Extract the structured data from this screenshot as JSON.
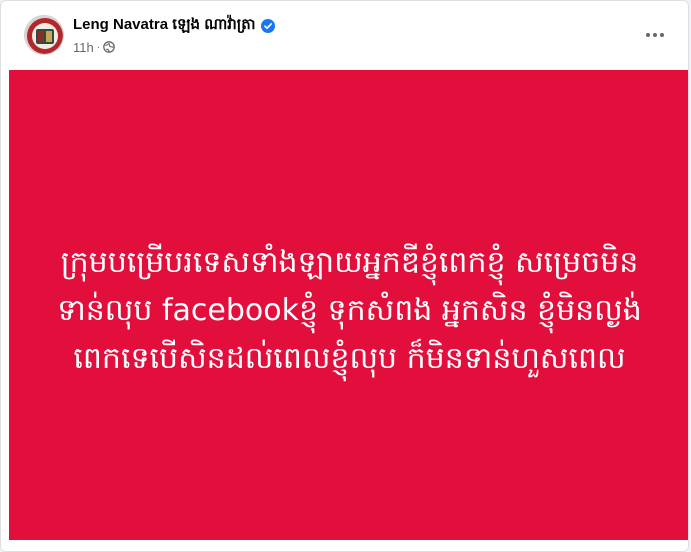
{
  "post": {
    "author_name": "Leng Navatra ឡេង ណាវ៉ាត្រា",
    "verified": true,
    "timestamp": "11h",
    "audience_icon": "globe-icon",
    "more_icon": "more-horizontal-icon",
    "avatar_icon": "profile-avatar-icon",
    "media_text": "ក្រុមបម្រើបរទេសទាំងឡាយអ្នកឌីខ្ញុំពេកខ្ញុំ សម្រេចមិនទាន់លុប facebookខ្ញុំ ទុកសំពង អ្នកសិន ខ្ញុំមិនល្ងង់ពេកទេបើសិនដល់ពេលខ្ញុំលុប ក៏មិនទាន់ហួសពេល"
  },
  "colors": {
    "media_background": "#e20e3c",
    "verified_badge": "#1877f2",
    "secondary_text": "#65676b",
    "primary_text": "#050505"
  }
}
